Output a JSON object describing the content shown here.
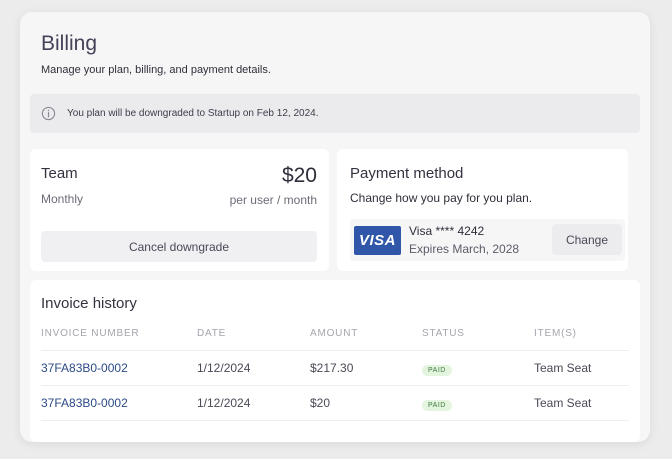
{
  "header": {
    "title": "Billing",
    "subtitle": "Manage your plan, billing, and payment details."
  },
  "notice": {
    "icon": "info-icon",
    "text": "You plan will be downgraded to Startup on Feb 12, 2024."
  },
  "plan": {
    "name": "Team",
    "cycle": "Monthly",
    "price": "$20",
    "unit": "per user / month",
    "cancel_label": "Cancel downgrade"
  },
  "payment": {
    "title": "Payment method",
    "subtitle": "Change how you pay for you plan.",
    "logo_text": "VISA",
    "card_number": "Visa **** 4242",
    "expires": "Expires March, 2028",
    "change_label": "Change",
    "brand_color": "#2f56a8"
  },
  "invoices": {
    "title": "Invoice history",
    "columns": [
      "INVOICE NUMBER",
      "DATE",
      "AMOUNT",
      "STATUS",
      "ITEM(S)"
    ],
    "rows": [
      {
        "number": "37FA83B0-0002",
        "date": "1/12/2024",
        "amount": "$217.30",
        "status": "PAID",
        "items": "Team Seat"
      },
      {
        "number": "37FA83B0-0002",
        "date": "1/12/2024",
        "amount": "$20",
        "status": "PAID",
        "items": "Team Seat"
      }
    ]
  },
  "colors": {
    "link": "#2c4a86",
    "paid_badge_bg": "#e3f4df",
    "paid_badge_text": "#3f7a3c"
  }
}
